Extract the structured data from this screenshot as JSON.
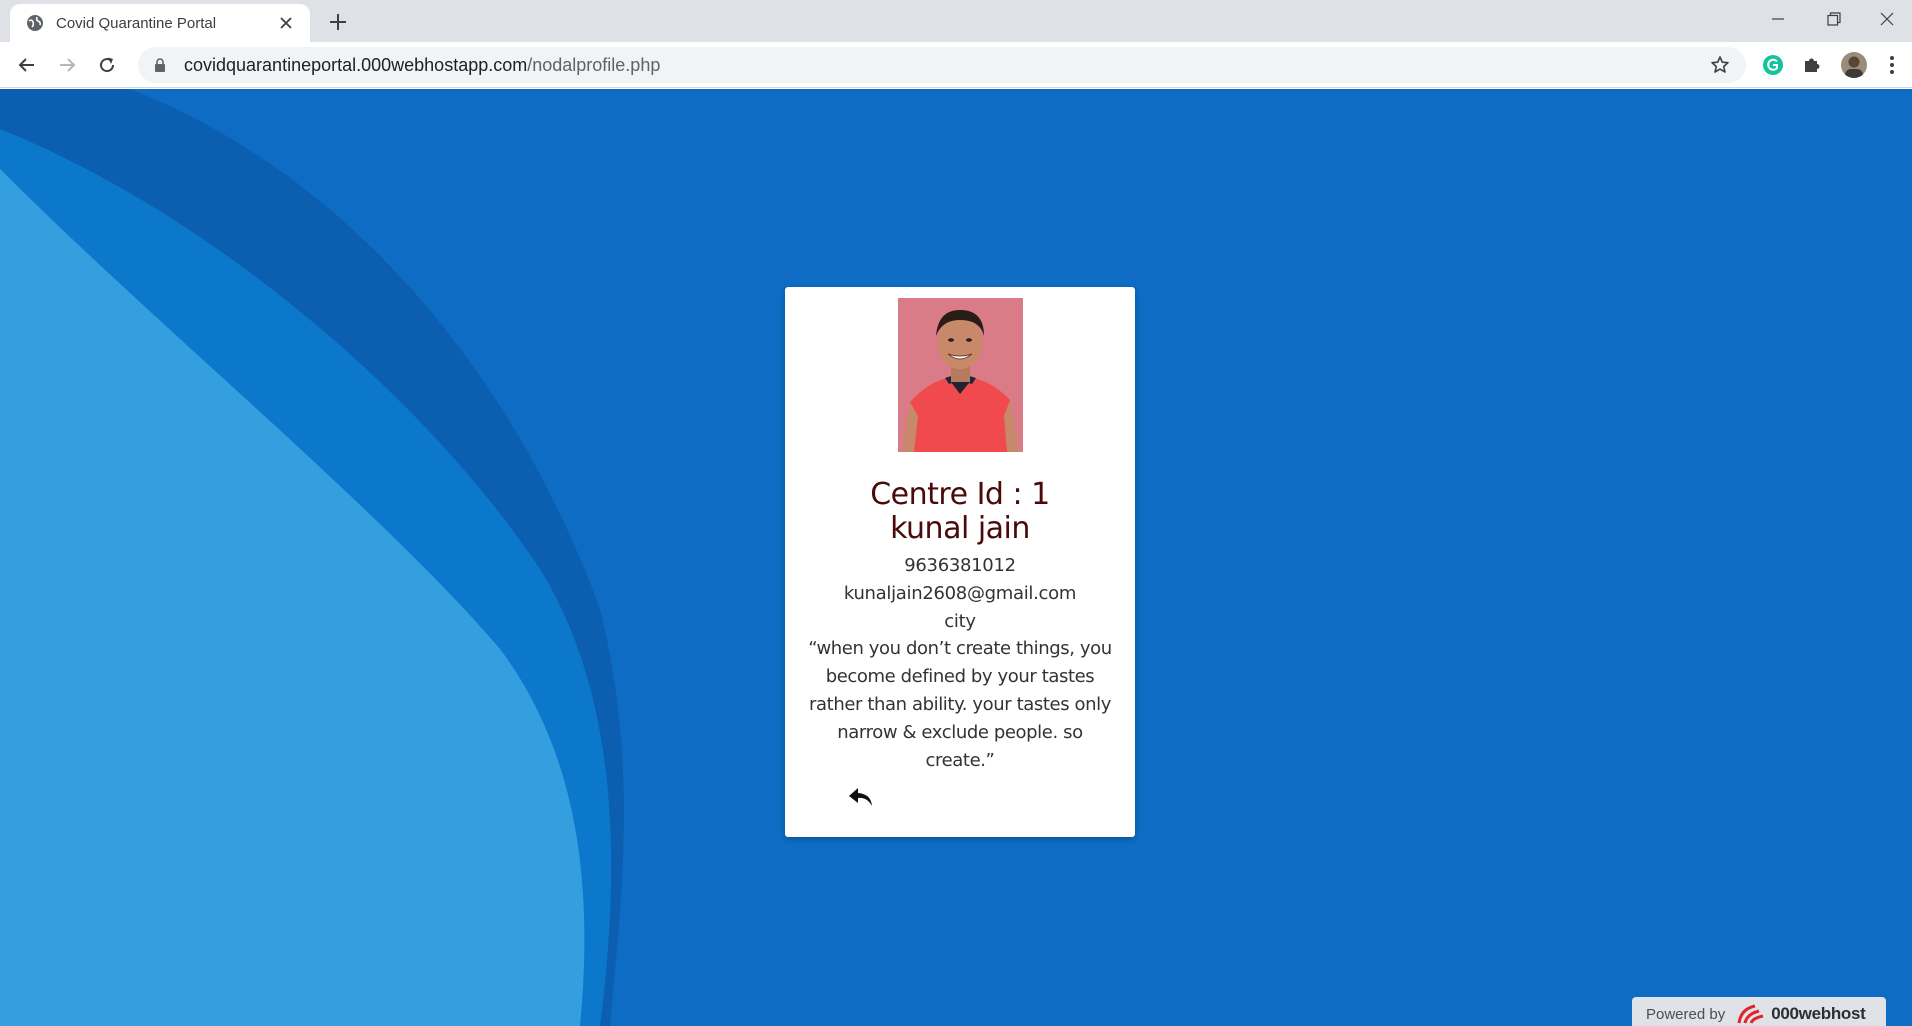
{
  "browser": {
    "tab_title": "Covid Quarantine Portal",
    "url_domain": "covidquarantineportal.000webhostapp.com",
    "url_path": "/nodalprofile.php"
  },
  "colors": {
    "page_background": "#0e6cc4",
    "wave_dark": "#0c5fb0",
    "wave_mid": "#0b78cc",
    "wave_light": "#349fde",
    "title_text": "#4a0a0a"
  },
  "profile": {
    "centre_id": "Centre Id : 1",
    "name": "kunal jain",
    "phone": "9636381012",
    "email": "kunaljain2608@gmail.com",
    "city": "city",
    "quote": "“when you don’t create things, you become defined by your tastes rather than ability. your tastes only narrow & exclude people. so create.”"
  },
  "footer": {
    "powered_by": "Powered by",
    "brand": "000webhost"
  }
}
